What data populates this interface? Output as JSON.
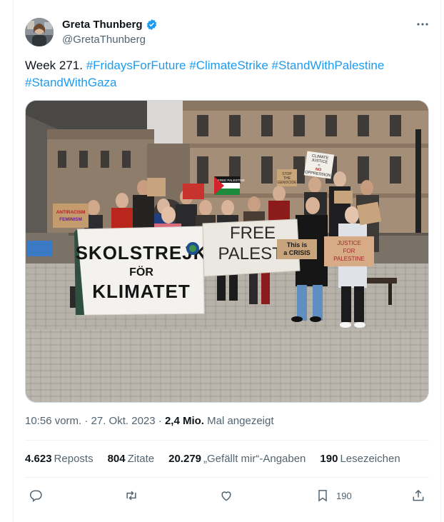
{
  "author": {
    "name": "Greta Thunberg",
    "handle": "@GretaThunberg"
  },
  "tweet": {
    "text_prefix": "Week 271. ",
    "hashtags": [
      "#FridaysForFuture",
      "#ClimateStrike",
      "#StandWithPalestine",
      "#StandWithGaza"
    ]
  },
  "photo": {
    "banner_left": [
      "SKOLSTREJK",
      "FÖR",
      "KLIMATET"
    ],
    "banner_center": [
      "FREE",
      "PALESTI"
    ],
    "sign_crisis": [
      "This is",
      "a CRISIS"
    ],
    "sign_justice": [
      "JUSTICE",
      "FOR",
      "PALESTINE"
    ],
    "sign_antiracism": [
      "ANTIRACISM",
      "FEMINISM"
    ],
    "sign_climate_justice": [
      "CLIMATE",
      "JUSTICE",
      "=",
      "NO",
      "OPPRESSION"
    ],
    "sign_stop": [
      "STOP",
      "THE",
      "GENOCIDE"
    ],
    "sign_free_palestine_small": "FREE PALESTINE"
  },
  "meta": {
    "time": "10:56 vorm. · 27. Okt. 2023 · ",
    "views": "2,4 Mio.",
    "views_label": " Mal angezeigt"
  },
  "stats": {
    "reposts_count": "4.623",
    "reposts_label": "Reposts",
    "quotes_count": "804",
    "quotes_label": "Zitate",
    "likes_count": "20.279",
    "likes_label": "„Gefällt mir“-Angaben",
    "bookmarks_count": "190",
    "bookmarks_label": "Lesezeichen"
  },
  "actions": {
    "bookmark_count": "190"
  },
  "colors": {
    "link": "#1d9bf0",
    "secondary_text": "#536471",
    "verified": "#1d9bf0"
  }
}
